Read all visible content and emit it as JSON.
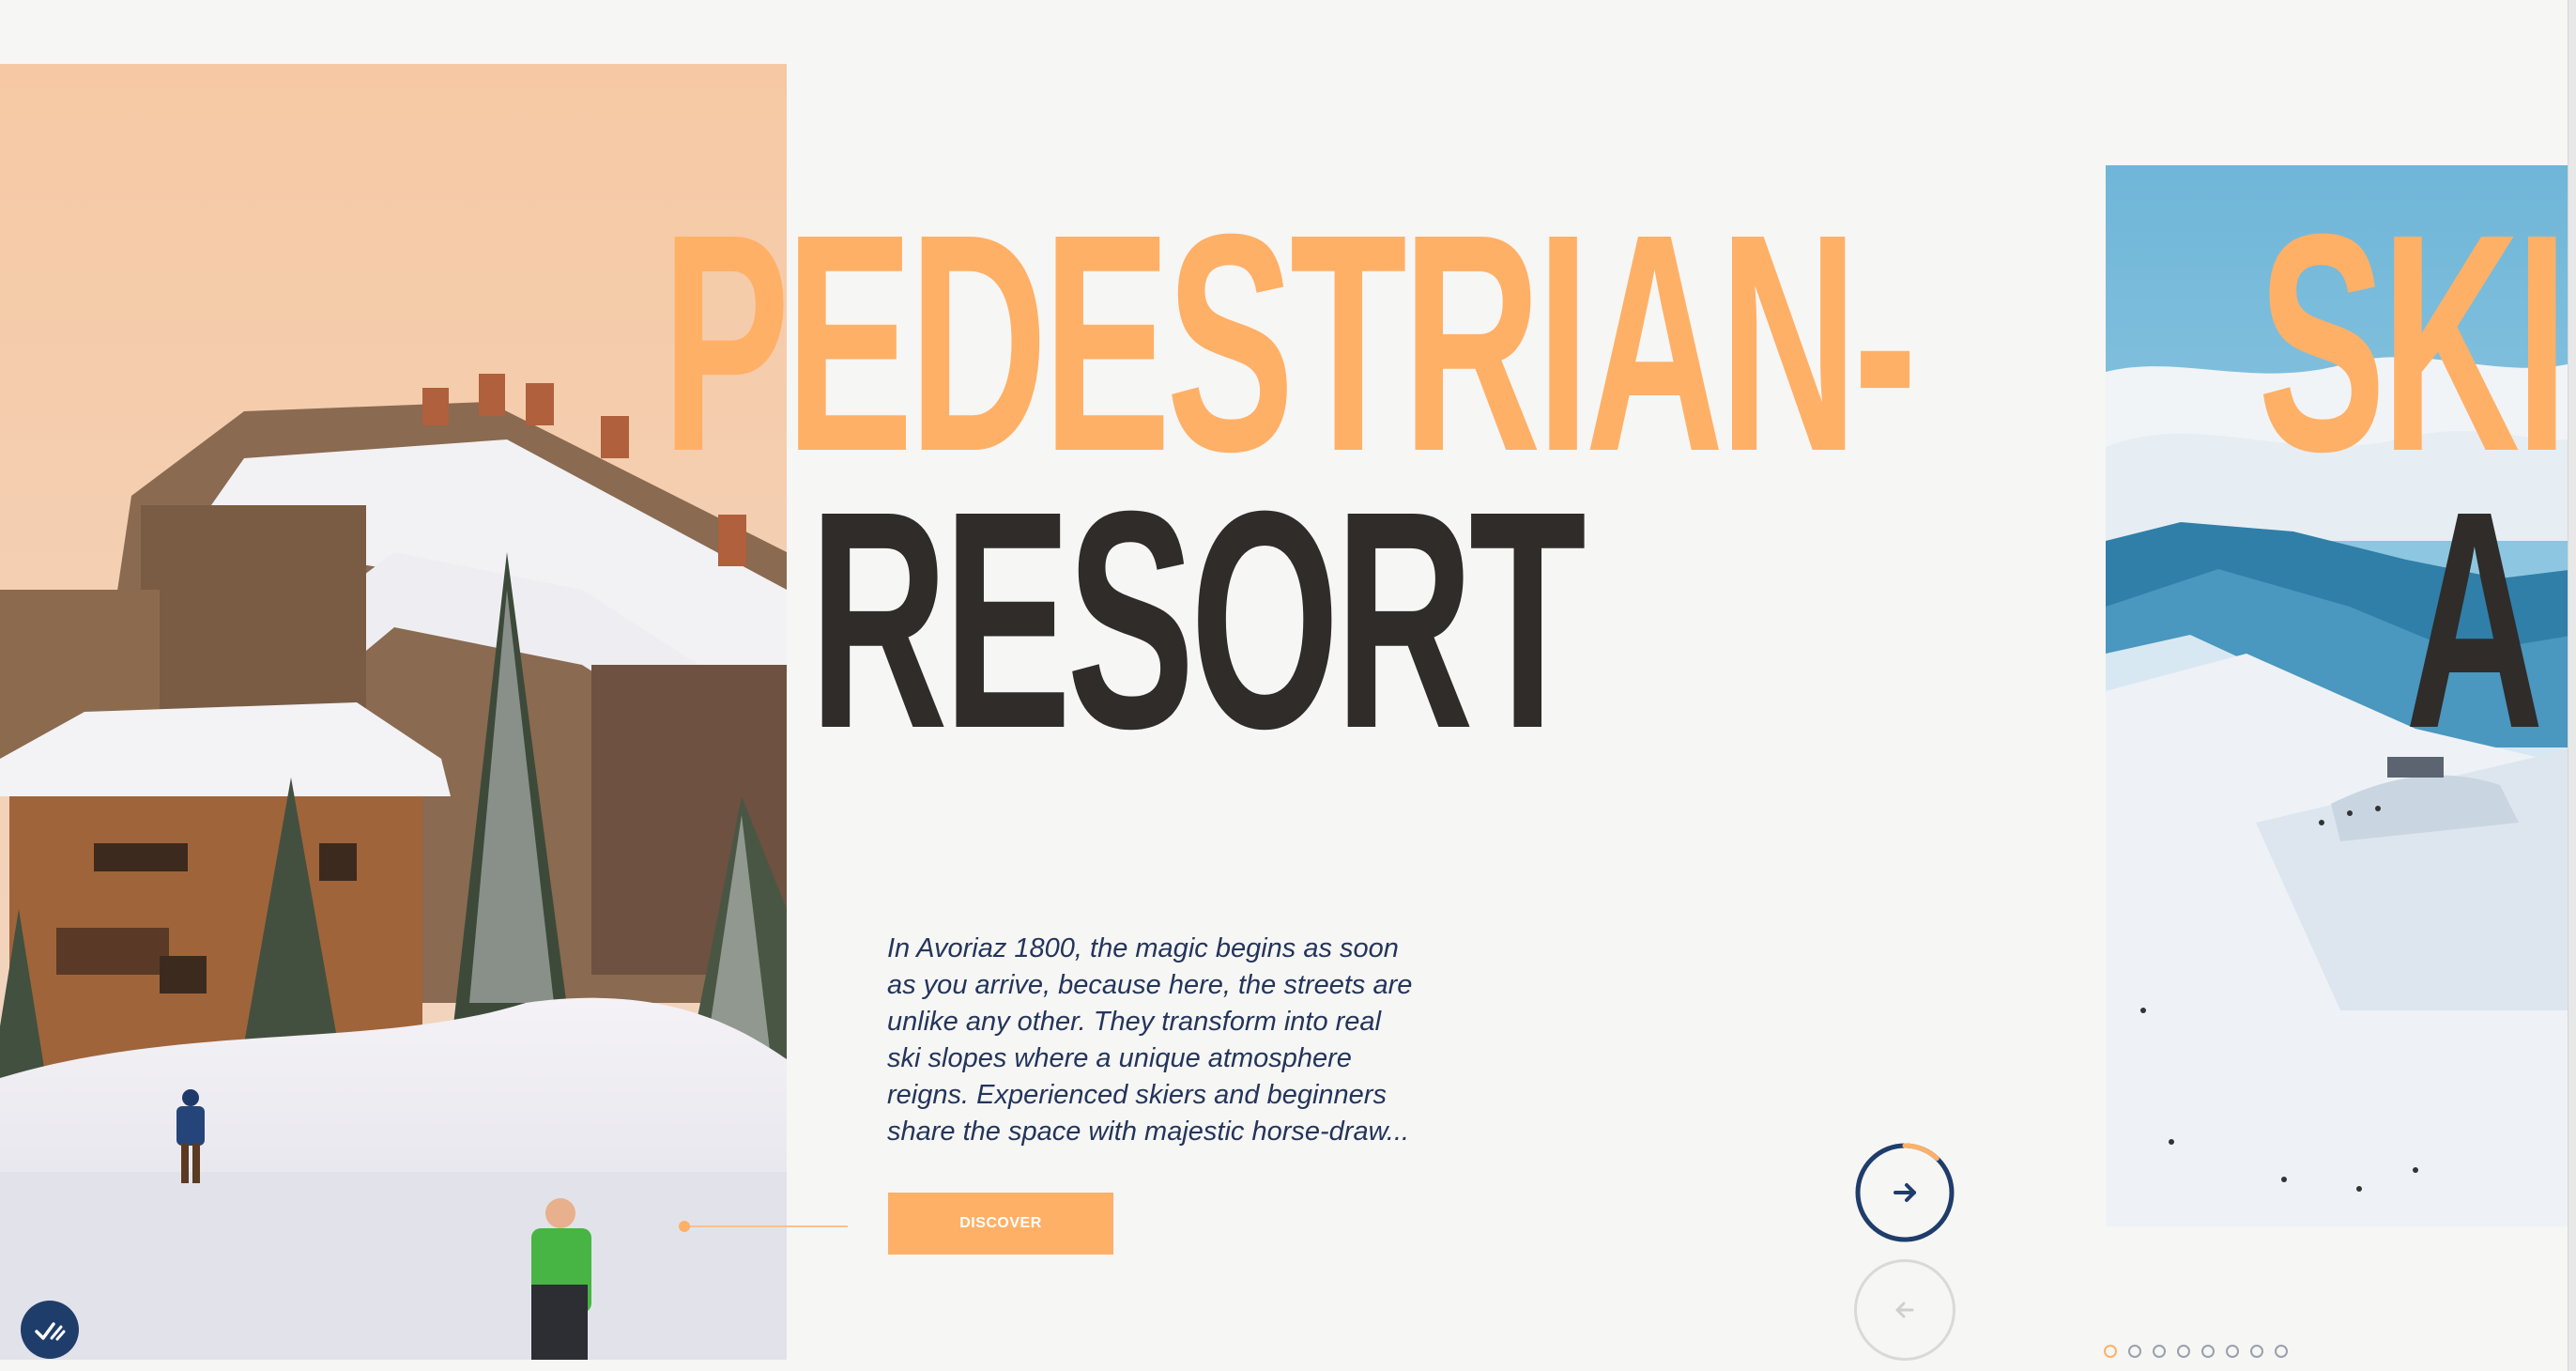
{
  "headline": {
    "line1": "PEDESTRIAN-",
    "line2": "RESORT"
  },
  "next_slide": {
    "line1": "SKI",
    "line2": "A"
  },
  "description": "In Avoriaz 1800, the magic begins as soon as you arrive, because here, the streets are unlike any other. They transform into real ski slopes where a unique atmosphere reigns. Experienced skiers and beginners share the space with majestic horse-draw...",
  "cta": {
    "discover_label": "DISCOVER"
  },
  "navigation": {
    "next_icon": "arrow-right-icon",
    "prev_icon": "arrow-left-icon",
    "progress": 0.12
  },
  "pagination": {
    "total": 8,
    "active_index": 0
  },
  "colors": {
    "accent": "#ffb067",
    "dark_text": "#2f2c2a",
    "navy": "#1f3d6b",
    "background": "#f6f6f4"
  }
}
